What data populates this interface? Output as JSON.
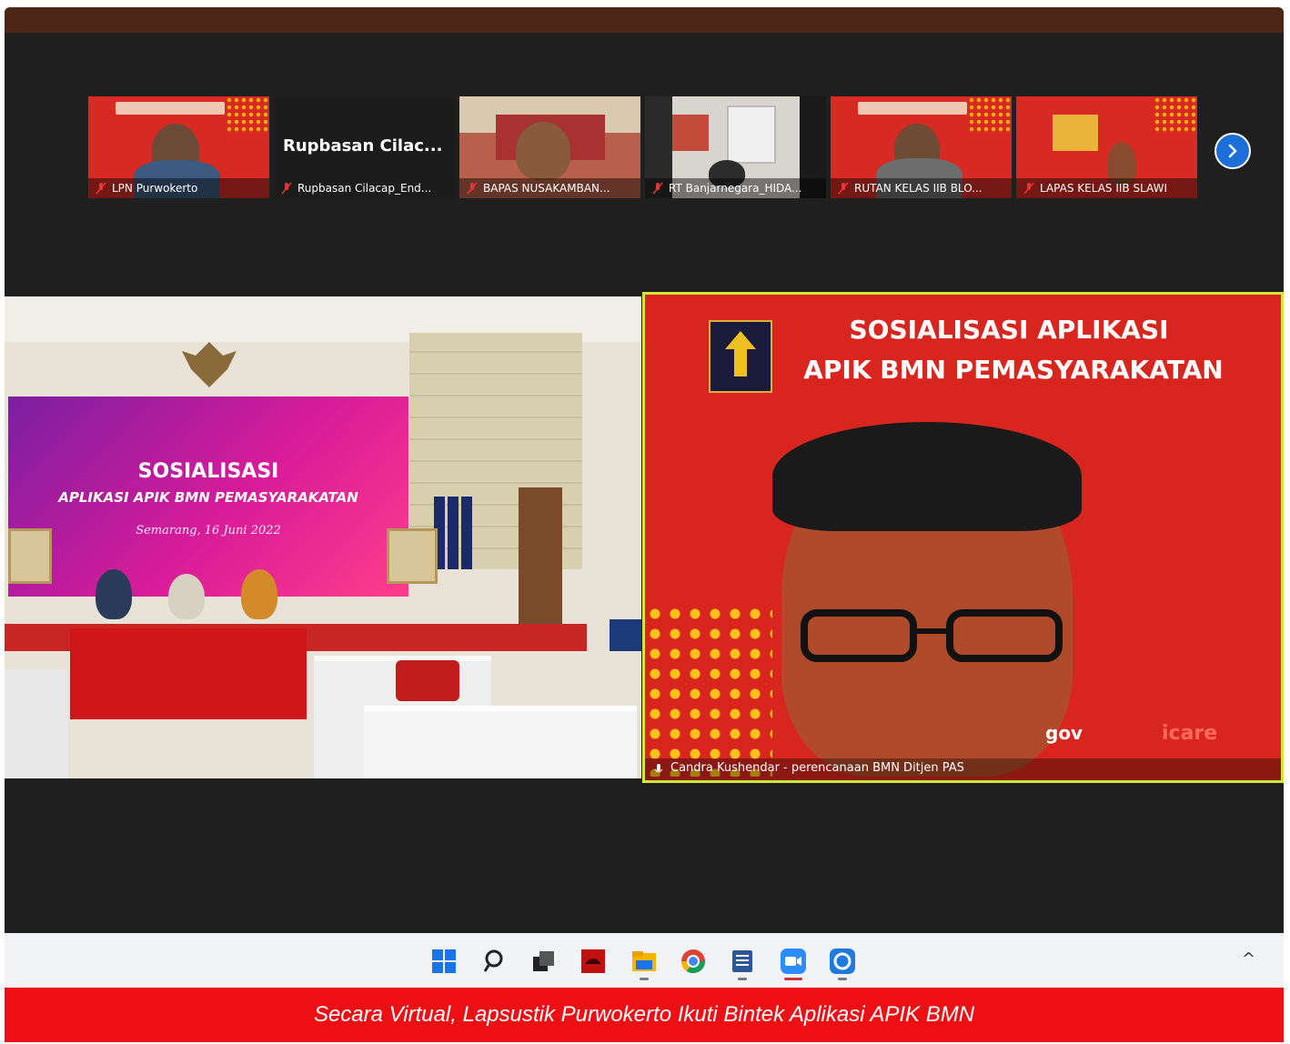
{
  "meeting": {
    "participants": [
      {
        "name": "LPN Purwokerto",
        "muted": true,
        "kind": "slide-person"
      },
      {
        "name": "Rupbasan Cilacap_End...",
        "muted": true,
        "kind": "name-only",
        "display_name": "Rupbasan  Cilac..."
      },
      {
        "name": "BAPAS NUSAKAMBAN...",
        "muted": true,
        "kind": "room-person"
      },
      {
        "name": "RT Banjarnegara_HIDA...",
        "muted": true,
        "kind": "office"
      },
      {
        "name": "RUTAN KELAS IIB BLO...",
        "muted": true,
        "kind": "slide-person"
      },
      {
        "name": "LAPAS KELAS IIB SLAWI",
        "muted": true,
        "kind": "slide-person"
      }
    ],
    "next_page_icon": "chevron-right-icon",
    "main_left": {
      "screen_title": "SOSIALISASI",
      "screen_subtitle": "APLIKASI APIK BMN PEMASYARAKATAN",
      "screen_date": "Semarang, 16 Juni 2022"
    },
    "main_right": {
      "slide_title_line1": "SOSIALISASI  APLIKASI",
      "slide_title_line2": "APIK BMN PEMASYARAKATAN",
      "logo_text_left": "gov",
      "logo_text_right": "icare",
      "speaker_name": "Candra Kushendar - perencanaan BMN Ditjen PAS"
    }
  },
  "taskbar": {
    "icons": [
      "windows-start-icon",
      "search-icon",
      "task-view-icon",
      "app-red-icon",
      "file-explorer-icon",
      "chrome-icon",
      "word-icon",
      "zoom-icon",
      "sync-icon"
    ],
    "tray_chevron": "^"
  },
  "caption": {
    "text": "Secara Virtual, Lapsustik Purwokerto Ikuti Bintek Aplikasi APIK BMN"
  },
  "colors": {
    "caption_bg": "#ee0f14",
    "slide_red": "#d62a22",
    "active_speaker_border": "#d5e63a",
    "zoom_blue": "#1e6ed9"
  }
}
